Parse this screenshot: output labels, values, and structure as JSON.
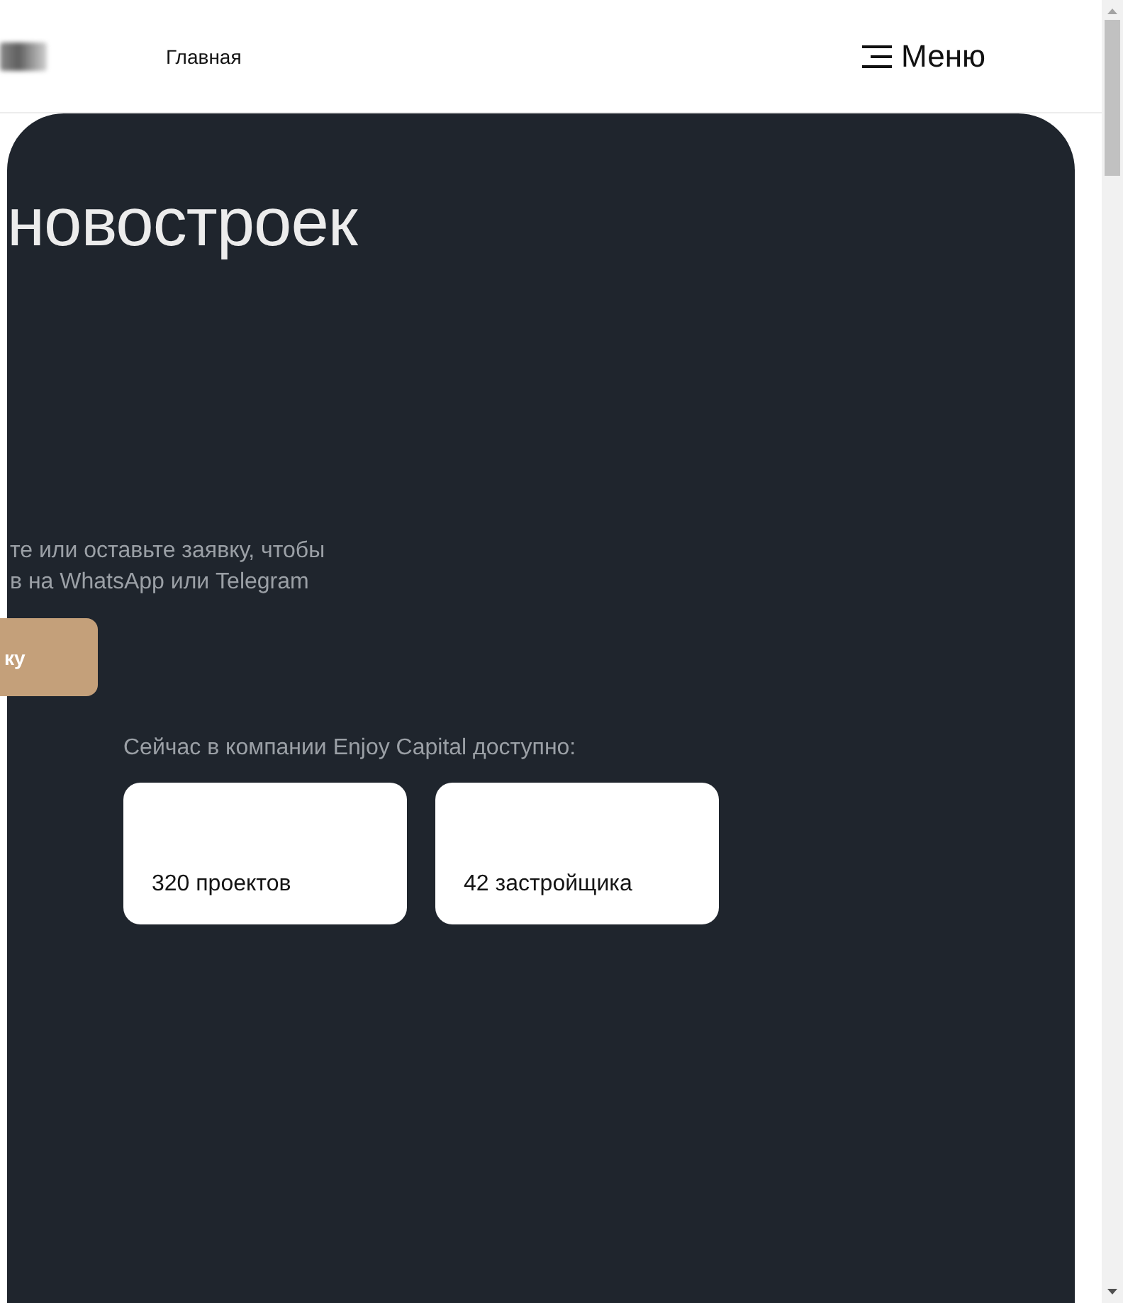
{
  "header": {
    "nav_link": "Главная",
    "menu_button": "Меню"
  },
  "hero": {
    "title": "новостроек",
    "description_lines": [
      "те или оставьте заявку, чтобы",
      "в на WhatsApp или Telegram"
    ],
    "cta_button": "ку"
  },
  "stats": {
    "caption": "Сейчас в компании Enjoy Capital доступно:",
    "cards": [
      "320 проектов",
      "42 застройщика"
    ]
  }
}
